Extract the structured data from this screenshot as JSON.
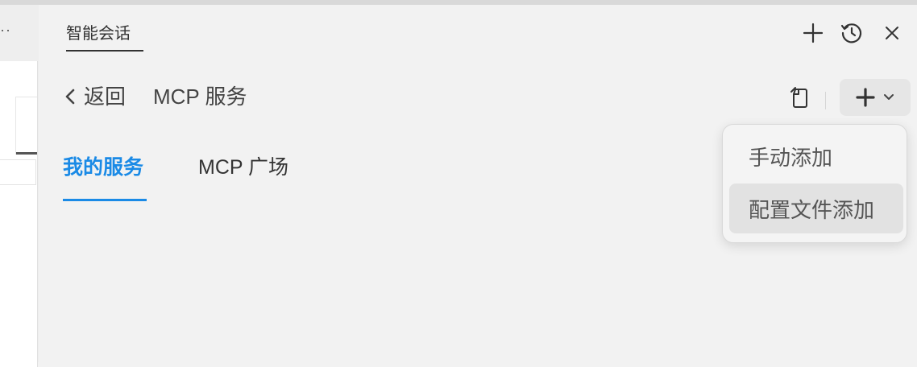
{
  "left_pane": {
    "overflow_dots": "··"
  },
  "header": {
    "tab_title": "智能会话",
    "icons": [
      "plus-icon",
      "history-icon",
      "close-icon"
    ]
  },
  "nav": {
    "back_label": "返回",
    "page_title": "MCP 服务"
  },
  "toolbar": {
    "icons": [
      "import-config-icon",
      "plus-icon",
      "chevron-down-icon"
    ]
  },
  "tabs": [
    {
      "label": "我的服务",
      "active": true
    },
    {
      "label": "MCP 广场",
      "active": false
    }
  ],
  "dropdown": {
    "items": [
      {
        "label": "手动添加",
        "highlighted": false
      },
      {
        "label": "配置文件添加",
        "highlighted": true
      }
    ]
  },
  "colors": {
    "accent": "#1a8ae6",
    "background": "#f2f2f2",
    "text": "#333333"
  }
}
